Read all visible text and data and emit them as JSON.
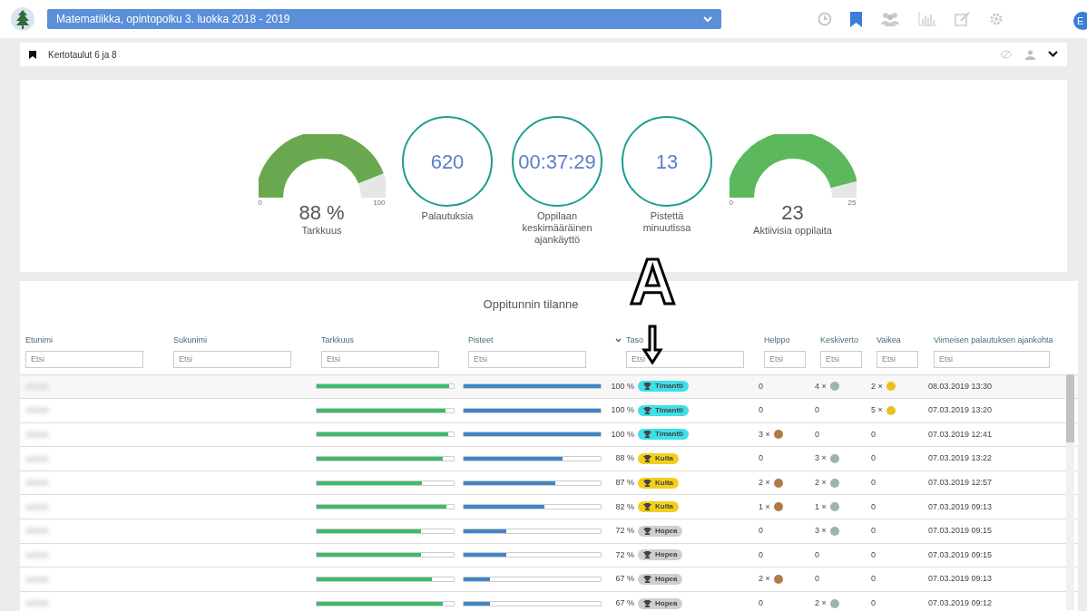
{
  "header": {
    "course": "Matematiikka, opintopolku 3. luokka 2018 - 2019",
    "avatar": "E"
  },
  "lesson": {
    "title": "Kertotaulut 6 ja 8"
  },
  "stats": [
    {
      "kind": "gauge",
      "min": "0",
      "max": "100",
      "value": "88 %",
      "label": "Tarkkuus"
    },
    {
      "kind": "circle",
      "value": "620",
      "label": "Palautuksia"
    },
    {
      "kind": "circle",
      "value": "00:37:29",
      "label": "Oppilaan keskimääräinen ajankäyttö"
    },
    {
      "kind": "circle",
      "value": "13",
      "label": "Pistettä minuutissa"
    },
    {
      "kind": "gauge",
      "min": "0",
      "max": "25",
      "value": "23",
      "label": "Aktiivisia oppilaita"
    }
  ],
  "table": {
    "title": "Oppitunnin tilanne",
    "columns": [
      {
        "label": "Etunimi",
        "placeholder": "Etsi",
        "sorted": false
      },
      {
        "label": "Sukunimi",
        "placeholder": "Etsi",
        "sorted": false
      },
      {
        "label": "Tarkkuus",
        "placeholder": "Etsi",
        "sorted": false
      },
      {
        "label": "Pisteet",
        "placeholder": "Etsi",
        "sorted": false
      },
      {
        "label": "Taso",
        "placeholder": "Etsi",
        "sorted": true
      },
      {
        "label": "Helppo",
        "placeholder": "Etsi",
        "sorted": false,
        "color": "#b07a45"
      },
      {
        "label": "Keskiverto",
        "placeholder": "Etsi",
        "sorted": false,
        "color": "#9fb3ad"
      },
      {
        "label": "Vaikea",
        "placeholder": "Etsi",
        "sorted": false,
        "color": "#e8c21e"
      },
      {
        "label": "Viimeisen palautuksen ajankohta",
        "placeholder": "Etsi",
        "sorted": false
      }
    ],
    "rows": [
      {
        "accuracy": {
          "level": 0.97
        },
        "points": {
          "level": 1.0
        },
        "percent": "100 %",
        "badge": {
          "kind": "diamond",
          "label": "Timantti"
        },
        "easy": {
          "count": "0",
          "medal": false
        },
        "medium": {
          "count": "4 ×",
          "medal": true
        },
        "hard": {
          "count": "2 ×",
          "medal": true
        },
        "time": "08.03.2019 13:30"
      },
      {
        "accuracy": {
          "level": 0.94
        },
        "points": {
          "level": 1.0
        },
        "percent": "100 %",
        "badge": {
          "kind": "diamond",
          "label": "Timantti"
        },
        "easy": {
          "count": "0",
          "medal": false
        },
        "medium": {
          "count": "0",
          "medal": false
        },
        "hard": {
          "count": "5 ×",
          "medal": true
        },
        "time": "07.03.2019 13:20"
      },
      {
        "accuracy": {
          "level": 0.96
        },
        "points": {
          "level": 1.0
        },
        "percent": "100 %",
        "badge": {
          "kind": "diamond",
          "label": "Timantti"
        },
        "easy": {
          "count": "3 ×",
          "medal": true
        },
        "medium": {
          "count": "0",
          "medal": false
        },
        "hard": {
          "count": "0",
          "medal": false
        },
        "time": "07.03.2019 12:41"
      },
      {
        "accuracy": {
          "level": 0.92
        },
        "points": {
          "level": 0.72
        },
        "percent": "88 %",
        "badge": {
          "kind": "gold",
          "label": "Kulta"
        },
        "easy": {
          "count": "0",
          "medal": false
        },
        "medium": {
          "count": "3 ×",
          "medal": true
        },
        "hard": {
          "count": "0",
          "medal": false
        },
        "time": "07.03.2019 13:22"
      },
      {
        "accuracy": {
          "level": 0.77
        },
        "points": {
          "level": 0.67
        },
        "percent": "87 %",
        "badge": {
          "kind": "gold",
          "label": "Kulta"
        },
        "easy": {
          "count": "2 ×",
          "medal": true
        },
        "medium": {
          "count": "2 ×",
          "medal": true
        },
        "hard": {
          "count": "0",
          "medal": false
        },
        "time": "07.03.2019 12:57"
      },
      {
        "accuracy": {
          "level": 0.95
        },
        "points": {
          "level": 0.59
        },
        "percent": "82 %",
        "badge": {
          "kind": "gold",
          "label": "Kulta"
        },
        "easy": {
          "count": "1 ×",
          "medal": true
        },
        "medium": {
          "count": "1 ×",
          "medal": true
        },
        "hard": {
          "count": "0",
          "medal": false
        },
        "time": "07.03.2019 09:13"
      },
      {
        "accuracy": {
          "level": 0.76
        },
        "points": {
          "level": 0.31
        },
        "percent": "72 %",
        "badge": {
          "kind": "silver",
          "label": "Hopea"
        },
        "easy": {
          "count": "0",
          "medal": false
        },
        "medium": {
          "count": "3 ×",
          "medal": true
        },
        "hard": {
          "count": "0",
          "medal": false
        },
        "time": "07.03.2019 09:15"
      },
      {
        "accuracy": {
          "level": 0.76
        },
        "points": {
          "level": 0.31
        },
        "percent": "72 %",
        "badge": {
          "kind": "silver",
          "label": "Hopea"
        },
        "easy": {
          "count": "0",
          "medal": false
        },
        "medium": {
          "count": "0",
          "medal": false
        },
        "hard": {
          "count": "0",
          "medal": false
        },
        "time": "07.03.2019 09:15"
      },
      {
        "accuracy": {
          "level": 0.84
        },
        "points": {
          "level": 0.19
        },
        "percent": "67 %",
        "badge": {
          "kind": "silver",
          "label": "Hopea"
        },
        "easy": {
          "count": "2 ×",
          "medal": true
        },
        "medium": {
          "count": "0",
          "medal": false
        },
        "hard": {
          "count": "0",
          "medal": false
        },
        "time": "07.03.2019 09:13"
      },
      {
        "accuracy": {
          "level": 0.92
        },
        "points": {
          "level": 0.19
        },
        "percent": "67 %",
        "badge": {
          "kind": "silver",
          "label": "Hopea"
        },
        "easy": {
          "count": "0",
          "medal": false
        },
        "medium": {
          "count": "2 ×",
          "medal": true
        },
        "hard": {
          "count": "0",
          "medal": false
        },
        "time": "07.03.2019 09:12"
      }
    ]
  },
  "annotation": {
    "letter": "A"
  }
}
